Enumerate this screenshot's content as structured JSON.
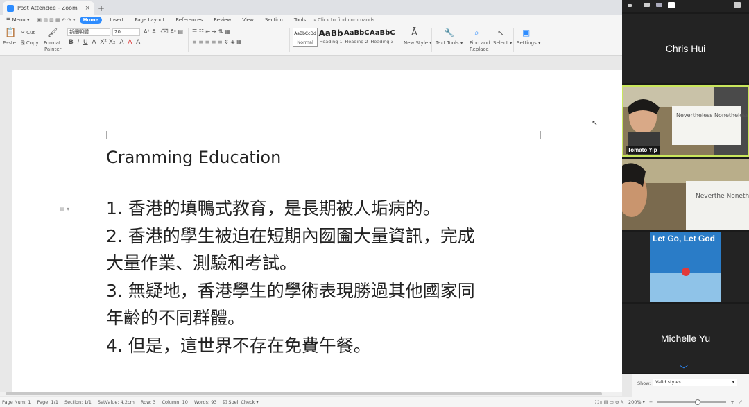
{
  "window": {
    "tab_title": "Post Attendee - Zoom",
    "tab_close": "×",
    "new_tab": "+"
  },
  "menubar": {
    "menu_label": "Menu",
    "tabs": [
      "Home",
      "Insert",
      "Page Layout",
      "References",
      "Review",
      "View",
      "Section",
      "Tools"
    ],
    "active_tab": "Home",
    "search_placeholder": "Click to find commands"
  },
  "ribbon": {
    "paste": "Paste",
    "cut": "Cut",
    "copy": "Copy",
    "format_painter_line1": "Format",
    "format_painter_line2": "Painter",
    "font_name": "新細明體",
    "font_size": "20",
    "styles": [
      {
        "preview": "AaBbCcDd",
        "label": "Normal"
      },
      {
        "preview": "AaBb",
        "label": "Heading 1"
      },
      {
        "preview": "AaBbC",
        "label": "Heading 2"
      },
      {
        "preview": "AaBbC",
        "label": "Heading 3"
      }
    ],
    "new_style": "New Style",
    "text_tools": "Text Tools",
    "find_replace_line1": "Find and",
    "find_replace_line2": "Replace",
    "select": "Select",
    "settings": "Settings"
  },
  "document": {
    "title": "Cramming Education",
    "lines": [
      "1.  香港的填鴨式教育，是長期被人垢病的。",
      "2.  香港的學生被迫在短期內囫圇大量資訊，完成",
      "大量作業、測驗和考試。",
      "3.  無疑地，香港學生的學術表現勝過其他國家同",
      "年齡的不同群體。",
      "4.  但是，這世界不存在免費午餐。"
    ]
  },
  "statusbar": {
    "items": [
      "Page Num: 1",
      "Page: 1/1",
      "Section: 1/1",
      "SetValue: 4.2cm",
      "Row: 3",
      "Column: 10",
      "Words: 93",
      "Spell Check"
    ],
    "zoom": "200%",
    "zoom_minus": "−",
    "zoom_plus": "+"
  },
  "styles_pane": {
    "show_label": "Show:",
    "show_value": "Valid styles"
  },
  "zoom": {
    "participants": [
      {
        "name": "Chris Hui",
        "video": false
      },
      {
        "name": "Tomato Yip",
        "video": true,
        "speaking": true,
        "board_text": "Nevertheless Nonetheless Yet"
      },
      {
        "name": "",
        "video": true,
        "board_text": "Neverthe Nonethe Yet"
      },
      {
        "name": "",
        "video": true,
        "poster_title": "Let Go, Let God"
      },
      {
        "name": "Michelle Yu",
        "video": false
      }
    ]
  }
}
